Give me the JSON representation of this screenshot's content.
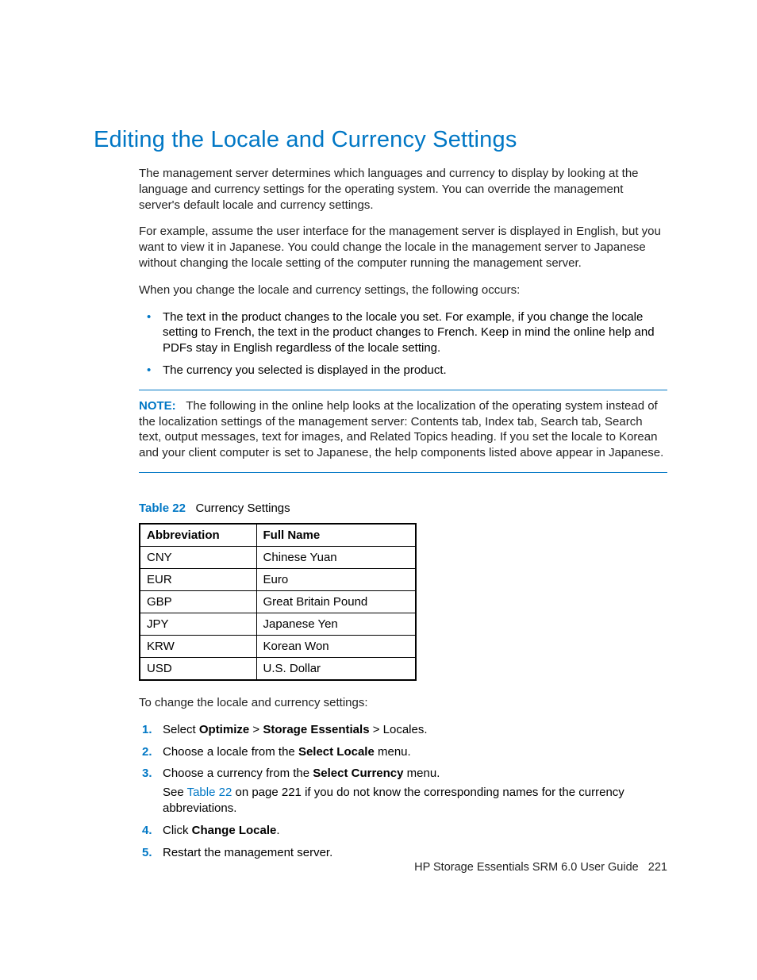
{
  "title": "Editing the Locale and Currency Settings",
  "para1": "The management server determines which languages and currency to display by looking at the language and currency settings for the operating system. You can override the management server's default locale and currency settings.",
  "para2": "For example, assume the user interface for the management server is displayed in English, but you want to view it in Japanese. You could change the locale in the management server to Japanese without changing the locale setting of the computer running the management server.",
  "para3": "When you change the locale and currency settings, the following occurs:",
  "bullets": [
    "The text in the product changes to the locale you set. For example, if you change the locale setting to French, the text in the product changes to French. Keep in mind the online help and PDFs stay in English regardless of the locale setting.",
    "The currency you selected is displayed in the product."
  ],
  "note_label": "NOTE:",
  "note_text": "The following in the online help looks at the localization of the operating system instead of the localization settings of the management server: Contents tab, Index tab, Search tab, Search text, output messages, text for images, and Related Topics heading. If you set the locale to Korean and your client computer is set to Japanese, the help components listed above appear in Japanese.",
  "table_label": "Table 22",
  "table_caption": "Currency Settings",
  "table_headers": {
    "col1": "Abbreviation",
    "col2": "Full Name"
  },
  "table_rows": [
    {
      "abbr": "CNY",
      "name": "Chinese Yuan"
    },
    {
      "abbr": "EUR",
      "name": "Euro"
    },
    {
      "abbr": "GBP",
      "name": "Great Britain Pound"
    },
    {
      "abbr": "JPY",
      "name": "Japanese Yen"
    },
    {
      "abbr": "KRW",
      "name": "Korean Won"
    },
    {
      "abbr": "USD",
      "name": "U.S. Dollar"
    }
  ],
  "para4": "To change the locale and currency settings:",
  "steps": {
    "s1": {
      "num": "1.",
      "before": "Select ",
      "b1": "Optimize",
      "mid1": " > ",
      "b2": "Storage Essentials",
      "after": " > Locales."
    },
    "s2": {
      "num": "2.",
      "before": "Choose a locale from the ",
      "b1": "Select Locale",
      "after": " menu."
    },
    "s3": {
      "num": "3.",
      "before": "Choose a currency from the ",
      "b1": "Select Currency",
      "after": " menu.",
      "sub_before": "See ",
      "sub_link": "Table 22",
      "sub_after": " on page 221 if you do not know the corresponding names for the currency abbreviations."
    },
    "s4": {
      "num": "4.",
      "before": "Click ",
      "b1": "Change Locale",
      "after": "."
    },
    "s5": {
      "num": "5.",
      "text": "Restart the management server."
    }
  },
  "footer_doc": "HP Storage Essentials SRM 6.0 User Guide",
  "footer_page": "221"
}
